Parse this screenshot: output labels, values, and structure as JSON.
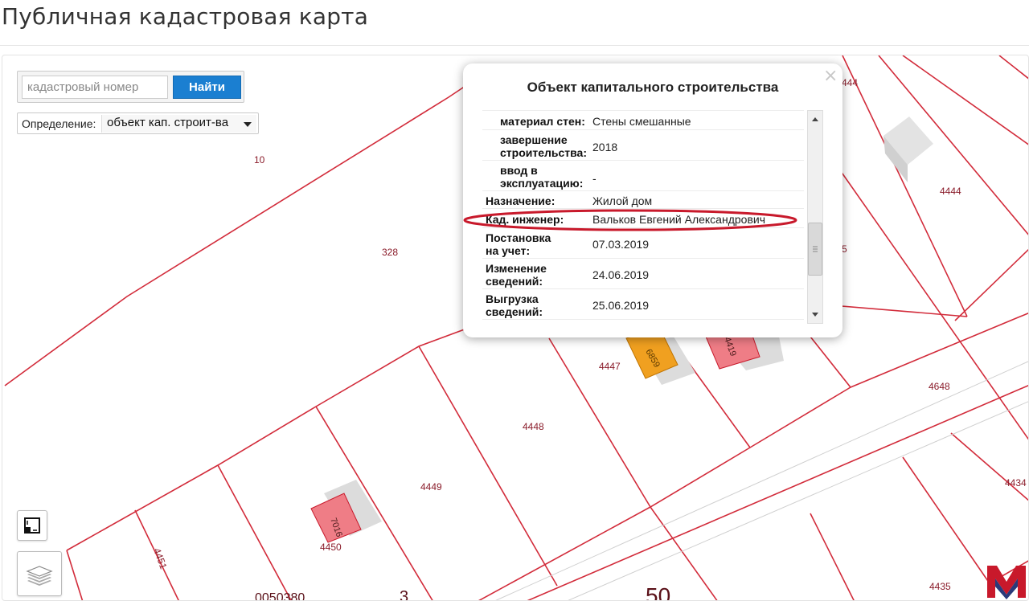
{
  "page_title": "Публичная кадастровая карта",
  "search": {
    "placeholder": "кадастровый номер",
    "button_label": "Найти"
  },
  "definition": {
    "label": "Определение:",
    "selected": "объект кап. строит-ва"
  },
  "popup": {
    "title": "Объект капитального строительства",
    "close_symbol": "×",
    "rows": [
      {
        "key_lines": [
          "материал стен"
        ],
        "value": "Стены смешанные"
      },
      {
        "key_lines": [
          "завершение",
          "строительства"
        ],
        "value": "2018"
      },
      {
        "key_lines": [
          "ввод в",
          "эксплуатацию"
        ],
        "value": "-"
      },
      {
        "key_lines": [
          "Назначение"
        ],
        "value": "Жилой дом"
      },
      {
        "key_lines": [
          "Кад. инженер"
        ],
        "value": "Вальков Евгений Александрович"
      },
      {
        "key_lines": [
          "Постановка",
          "на учет"
        ],
        "value": "07.03.2019"
      },
      {
        "key_lines": [
          "Изменение",
          "сведений"
        ],
        "value": "24.06.2019"
      },
      {
        "key_lines": [
          "Выгрузка",
          "сведений"
        ],
        "value": "25.06.2019"
      }
    ],
    "highlight_color": "#c8192b"
  },
  "map": {
    "parcel_color": "#d22b3a",
    "label_color": "#8a1c2a",
    "parcel_labels": [
      "10",
      "328",
      "4444",
      "4447",
      "4448",
      "4449",
      "4450",
      "4451",
      "4648",
      "4434",
      "4435",
      "0050380",
      "3",
      "50",
      "444",
      "5"
    ],
    "building_labels": [
      "7016",
      "6859",
      "4419"
    ]
  },
  "controls": {
    "ruler_icon": "ruler-icon",
    "layers_icon": "layers-icon"
  },
  "logo_color": "#c8192b"
}
